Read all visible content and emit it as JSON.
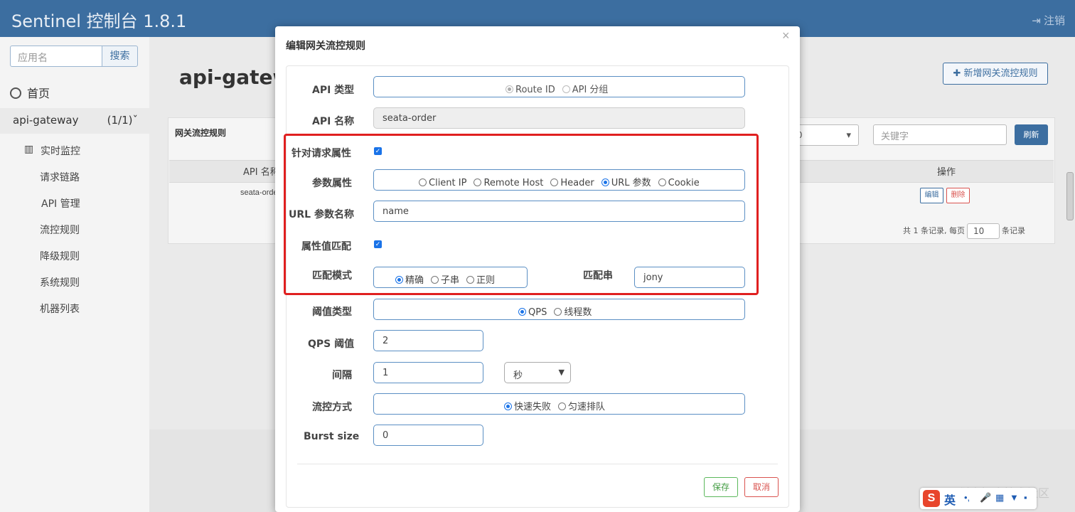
{
  "app": {
    "title": "Sentinel 控制台 1.8.1",
    "logout": "注销"
  },
  "sidebar": {
    "search_placeholder": "应用名",
    "search_button": "搜索",
    "home": "首页",
    "app_name": "api-gateway",
    "app_count": "(1/1)",
    "items": [
      "实时监控",
      "请求链路",
      "API 管理",
      "流控规则",
      "降级规则",
      "系统规则",
      "机器列表"
    ]
  },
  "page": {
    "title": "api-gatewa",
    "add_button": "新增网关流控规则",
    "panel_title": "网关流控规则",
    "select_value": "0",
    "keyword_placeholder": "关键字",
    "refresh": "刷新",
    "col_api": "API 名称",
    "col_ops": "操作",
    "row_api": "seata-orde",
    "edit": "编辑",
    "delete": "删除",
    "pager_prefix": "共 1 条记录, 每页",
    "page_size": "10",
    "pager_suffix": "条记录"
  },
  "modal": {
    "title": "编辑网关流控规则",
    "close": "×",
    "api_type_label": "API 类型",
    "api_type_options": [
      "Route ID",
      "API 分组"
    ],
    "api_type_selected": "Route ID",
    "api_name_label": "API 名称",
    "api_name_value": "seata-order",
    "req_attr_label": "针对请求属性",
    "req_attr_checked": true,
    "param_attr_label": "参数属性",
    "param_attr_options": [
      "Client IP",
      "Remote Host",
      "Header",
      "URL 参数",
      "Cookie"
    ],
    "param_attr_selected": "URL 参数",
    "url_param_label": "URL 参数名称",
    "url_param_value": "name",
    "attr_match_label": "属性值匹配",
    "attr_match_checked": true,
    "match_mode_label": "匹配模式",
    "match_mode_options": [
      "精确",
      "子串",
      "正则"
    ],
    "match_mode_selected": "精确",
    "match_str_label": "匹配串",
    "match_str_value": "jony",
    "threshold_type_label": "阈值类型",
    "threshold_type_options": [
      "QPS",
      "线程数"
    ],
    "threshold_type_selected": "QPS",
    "qps_label": "QPS 阈值",
    "qps_value": "2",
    "interval_label": "间隔",
    "interval_value": "1",
    "interval_unit": "秒",
    "control_label": "流控方式",
    "control_options": [
      "快速失败",
      "匀速排队"
    ],
    "control_selected": "快速失败",
    "burst_label": "Burst size",
    "burst_value": "0",
    "save": "保存",
    "cancel": "取消"
  },
  "watermark": "@稀土掘金技术社区",
  "ime": {
    "logo": "S",
    "mode": "英"
  },
  "colors": {
    "topbar": "#3c6ea0",
    "highlight_box": "#e02020",
    "radio_accent": "#1a73e8"
  }
}
